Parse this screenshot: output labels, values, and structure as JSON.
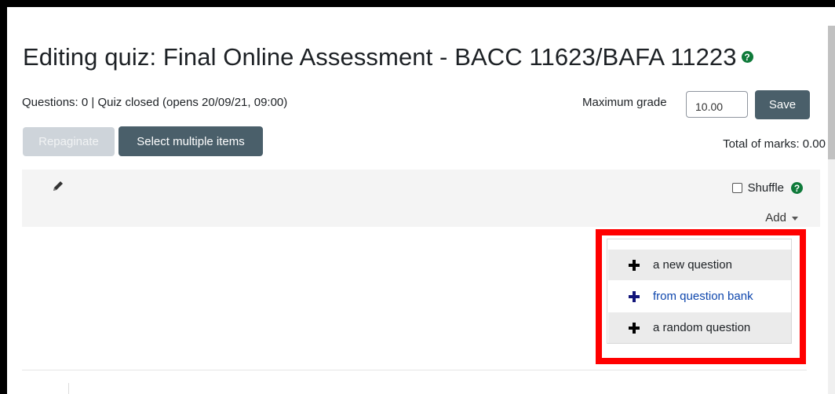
{
  "page": {
    "title": "Editing quiz: Final Online Assessment - BACC 11623/BAFA 11223",
    "help_glyph": "?"
  },
  "quiz": {
    "info": "Questions: 0 | Quiz closed (opens 20/09/21, 09:00)",
    "max_grade_label": "Maximum grade",
    "max_grade_value": "10.00",
    "save_label": "Save",
    "total_marks": "Total of marks: 0.00"
  },
  "toolbar": {
    "repaginate_label": "Repaginate",
    "select_multiple_label": "Select multiple items"
  },
  "section": {
    "shuffle_label": "Shuffle",
    "add_label": "Add"
  },
  "add_menu": {
    "items": [
      {
        "label": "a new question",
        "icon": "plus-icon"
      },
      {
        "label": "from question bank",
        "icon": "plus-icon"
      },
      {
        "label": "a random question",
        "icon": "plus-icon"
      }
    ]
  },
  "colors": {
    "help_green": "#0f7a3a",
    "button_dark": "#4a5f6a",
    "link_blue": "#0f47ad",
    "highlight_red": "#ff0000"
  }
}
